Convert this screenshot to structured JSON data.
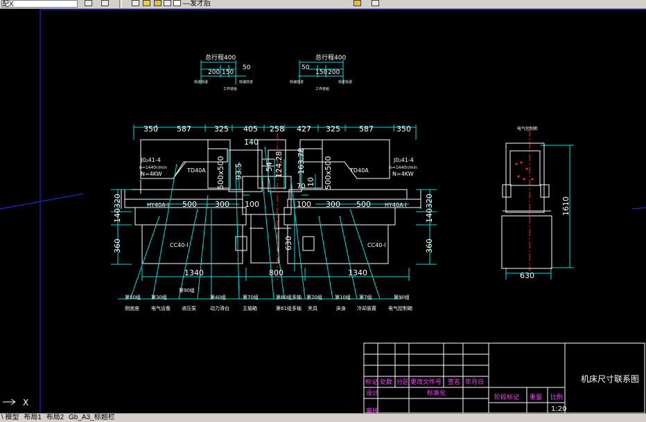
{
  "toolbar": {
    "layer_text": "配X",
    "linetype_text": "—发才后"
  },
  "drawing": {
    "top_left_detail": {
      "total": "总行程400",
      "d1": "200",
      "d2": "150",
      "d3": "50",
      "lbl_a": "快进快退",
      "lbl_b": "工作进给",
      "lbl_c": "快速前进"
    },
    "top_right_detail": {
      "total": "总行程400",
      "d1": "150",
      "d2": "200",
      "d3": "50",
      "lbl_a": "快速前进",
      "lbl_b": "工作进给",
      "lbl_c": "快进快退"
    },
    "top_dims": [
      "350",
      "587",
      "325",
      "405",
      "258",
      "427",
      "325",
      "587",
      "350"
    ],
    "motor_left": [
      "J0₂41-4",
      "n=1440r/min",
      "N=4KW"
    ],
    "motor_right": [
      "J0₂41-4",
      "n=1440r/min",
      "N=4KW"
    ],
    "head_left": "TD40A",
    "head_right": "TD40A",
    "slide_left": "HY40A-I",
    "slide_right": "HY40A-I",
    "base_left": "CC40-I",
    "base_right": "CC40-I",
    "dim_140": "140",
    "dim_500x500_l": "500x500",
    "dim_500x500_r": "500x500",
    "dim_935": "93.5",
    "dim_54": "54",
    "dim_12428": "124.28",
    "dim_16378": "163.78",
    "dim_10": "10",
    "dim_70": "70",
    "dim_500_l": "500",
    "dim_300_l": "300",
    "dim_100_l": "100",
    "dim_100_r": "100",
    "dim_300_r": "300",
    "dim_500_r": "500",
    "dim_320_l": "320",
    "dim_140_l": "140",
    "dim_360_l": "360",
    "dim_320_r": "320",
    "dim_140_r": "140",
    "dim_360_r": "360",
    "dim_630_mid": "630",
    "dim_1340_l": "1340",
    "dim_800": "800",
    "dim_1340_r": "1340",
    "callouts": [
      {
        "n": "第50组",
        "t": "侧底座"
      },
      {
        "n": "第30组",
        "t": "电气设备"
      },
      {
        "n": "第90组",
        "t": "液压泵"
      },
      {
        "n": "第40组",
        "t": "动力滑台"
      },
      {
        "n": "第70组",
        "t": "主轴箱"
      },
      {
        "n": "第60组多轴",
        "t": "第61组多轴"
      },
      {
        "n": "第20组",
        "t": "夹具"
      },
      {
        "n": "第10组",
        "t": "床身"
      },
      {
        "n": "第7组",
        "t": "冷却装置"
      },
      {
        "n": "第90组",
        "t": "电气控制箱"
      }
    ],
    "side_view": {
      "top_label": "电气控制柜",
      "height": "1610",
      "width": "630"
    }
  },
  "title_block": {
    "drawing_title": "机床尺寸联系图",
    "row_labels": [
      "标记",
      "处数",
      "分区",
      "更改文件号",
      "签名",
      "年月日"
    ],
    "design": "设计",
    "standard": "标准化",
    "stage_mark": "阶段标记",
    "weight": "重量",
    "scale_label": "比例",
    "scale_value": "1:20",
    "audit": "审核"
  },
  "axis_label": "X",
  "tabs": [
    "\\ 模型",
    "布局1",
    "布局2",
    "Gb_A3_标题栏"
  ]
}
